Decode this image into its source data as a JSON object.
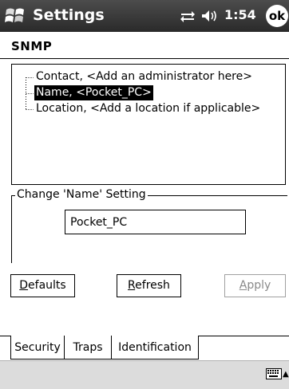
{
  "titlebar": {
    "app_title": "Settings",
    "clock": "1:54",
    "ok_label": "ok"
  },
  "page": {
    "title": "SNMP"
  },
  "tree": {
    "items": [
      {
        "label": "Contact, <Add an administrator here>",
        "selected": false
      },
      {
        "label": "Name, <Pocket_PC>",
        "selected": true
      },
      {
        "label": "Location, <Add a location if applicable>",
        "selected": false
      }
    ]
  },
  "setting": {
    "legend": "Change 'Name' Setting",
    "value": "Pocket_PC"
  },
  "buttons": {
    "defaults_ul": "D",
    "defaults_rest": "efaults",
    "refresh_ul": "R",
    "refresh_rest": "efresh",
    "apply_ul": "A",
    "apply_rest": "pply"
  },
  "tabs": {
    "security": "Security",
    "traps": "Traps",
    "identification": "Identification",
    "active": "identification"
  },
  "colors": {
    "titlebar": "#3a3a3a",
    "selection": "#000000",
    "disabled_text": "#8a8a8a",
    "menu_bar": "#dcdcdc"
  }
}
